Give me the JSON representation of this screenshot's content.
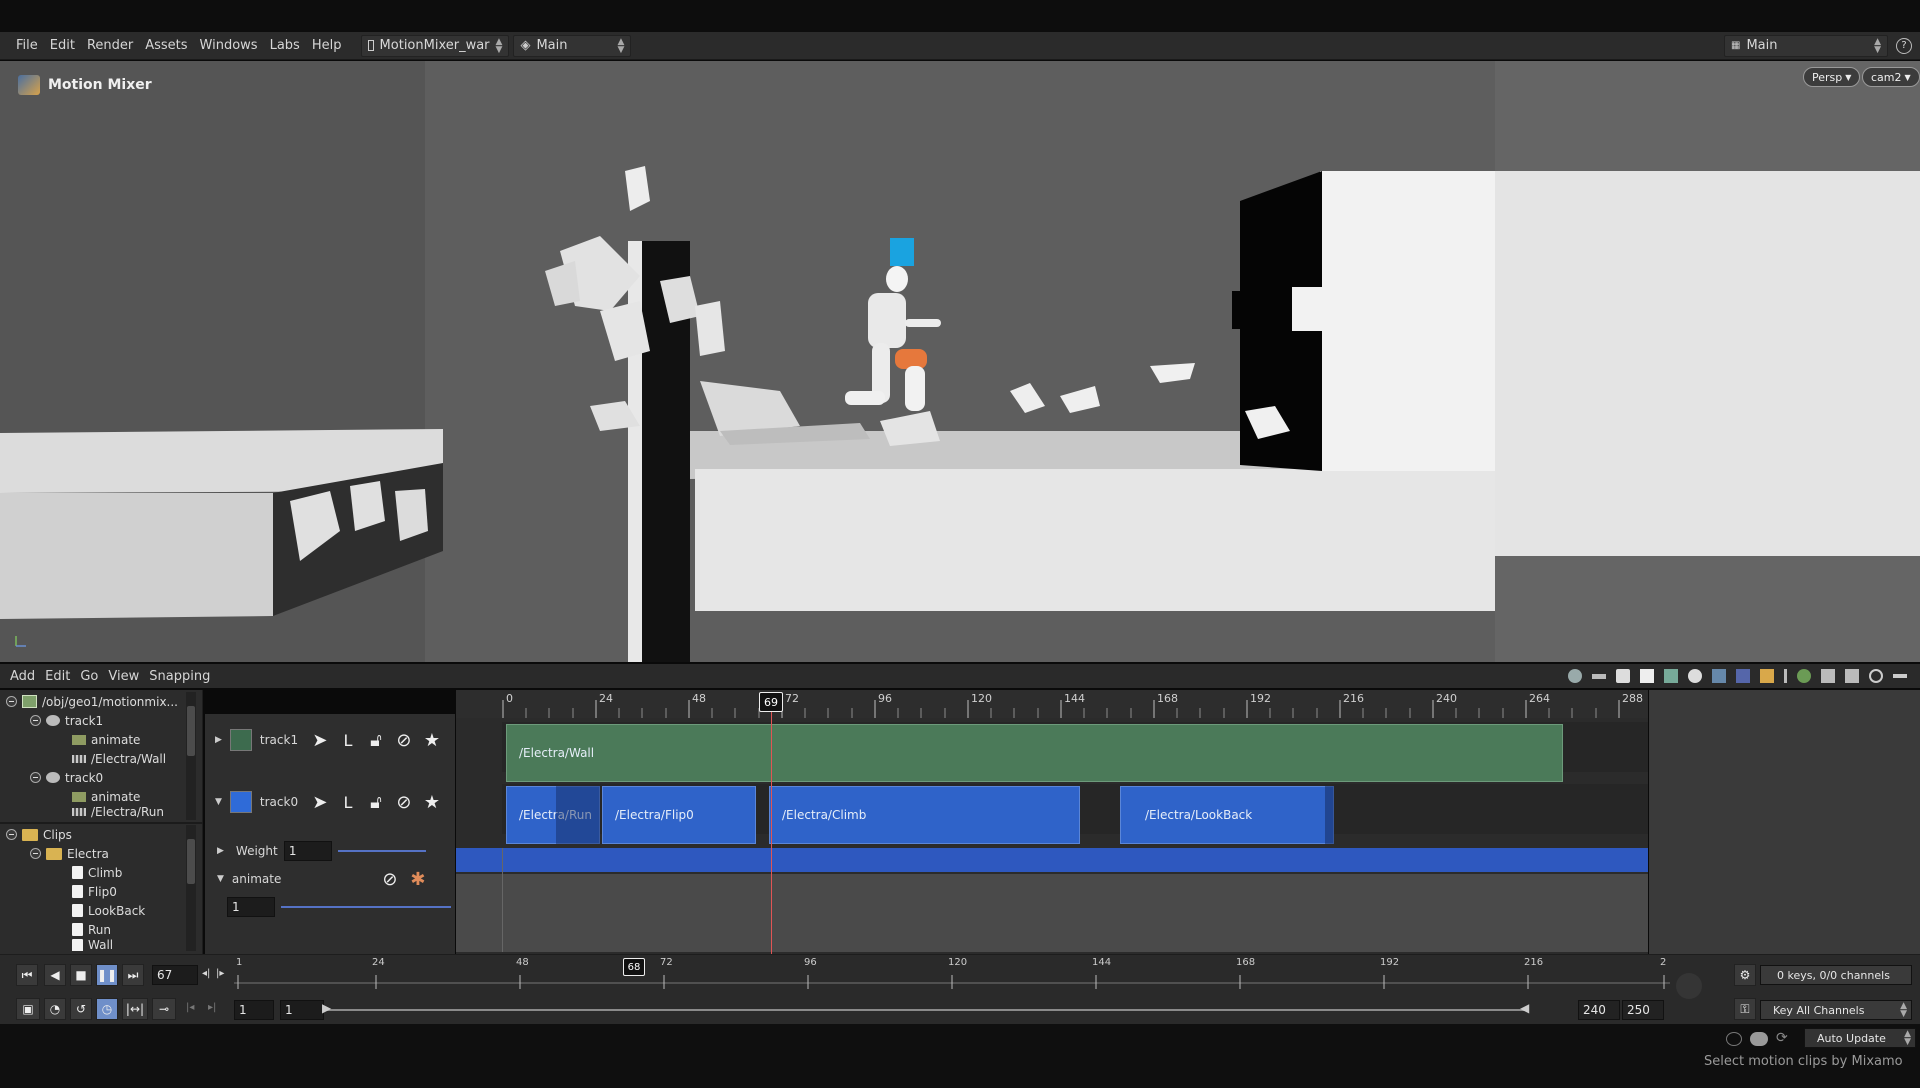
{
  "menu": {
    "items": [
      "File",
      "Edit",
      "Render",
      "Assets",
      "Windows",
      "Labs",
      "Help"
    ]
  },
  "desktop": {
    "scene_tab": "MotionMixer_war",
    "context": "Main",
    "layout": "Main"
  },
  "viewport": {
    "title": "Motion Mixer",
    "persp_label": "Persp",
    "cam_label": "cam2"
  },
  "mixer_menu": {
    "items": [
      "Add",
      "Edit",
      "Go",
      "View",
      "Snapping"
    ]
  },
  "tree": {
    "path": "/obj/geo1/motionmix...",
    "track1": "track1",
    "track1_animate": "animate",
    "track1_clip": "/Electra/Wall",
    "track0": "track0",
    "track0_animate": "animate",
    "track0_clip": "/Electra/Run",
    "clips_root": "Clips",
    "clips_folder": "Electra",
    "clip_names": [
      "Climb",
      "Flip0",
      "LookBack",
      "Run",
      "Wall"
    ]
  },
  "tracks": {
    "track1_name": "track1",
    "track0_name": "track0",
    "track1_color": "#3d6b4e",
    "track0_color": "#2f6bd8",
    "weight_label": "Weight",
    "weight_value": "1",
    "animate_label": "animate",
    "animate_value": "1"
  },
  "ruler": {
    "ticks": [
      "0",
      "24",
      "48",
      "72",
      "96",
      "120",
      "144",
      "168",
      "192",
      "216",
      "240",
      "264",
      "288"
    ],
    "current_frame": "69"
  },
  "clips": {
    "wall": "/Electra/Wall",
    "run": "/Electra/Run",
    "flip": "/Electra/Flip0",
    "climb": "/Electra/Climb",
    "lookback": "/Electra/LookBack",
    "green": "#4b7a59",
    "blue": "#2f63c9"
  },
  "playbar": {
    "frame": "67",
    "current_frame": "68",
    "ticks": [
      "1",
      "24",
      "48",
      "72",
      "96",
      "120",
      "144",
      "168",
      "192",
      "216",
      "2"
    ],
    "range_start": "1",
    "range_start2": "1",
    "range_end": "240",
    "range_end2": "250"
  },
  "right_panel": {
    "keys_info": "0 keys, 0/0 channels",
    "key_channels": "Key All Channels",
    "auto_update": "Auto Update"
  },
  "status": {
    "message": "Select motion clips by Mixamo"
  }
}
